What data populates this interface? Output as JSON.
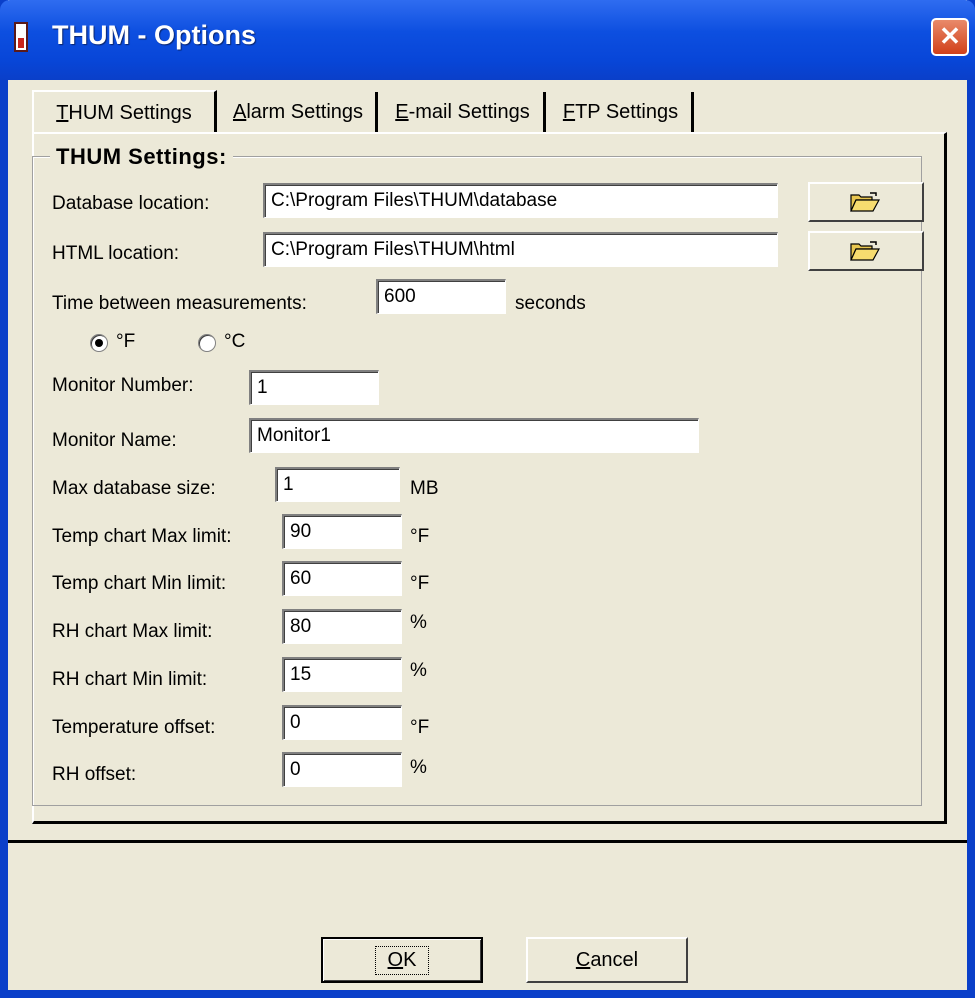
{
  "window": {
    "title": "THUM - Options",
    "close_glyph": "✕"
  },
  "tabs": [
    {
      "label": "THUM Settings",
      "mnemonic": "T",
      "rest": "HUM Settings",
      "active": true
    },
    {
      "label": "Alarm Settings",
      "mnemonic": "A",
      "rest": "larm Settings",
      "active": false
    },
    {
      "label": "E-mail Settings",
      "mnemonic": "E",
      "rest": "-mail Settings",
      "active": false
    },
    {
      "label": "FTP Settings",
      "mnemonic": "F",
      "rest": "TP Settings",
      "active": false
    }
  ],
  "group": {
    "title": "THUM Settings:"
  },
  "fields": {
    "database_location": {
      "label": "Database location:",
      "value": "C:\\Program Files\\THUM\\database"
    },
    "html_location": {
      "label": "HTML location:",
      "value": "C:\\Program Files\\THUM\\html"
    },
    "time_between": {
      "label": "Time between measurements:",
      "value": "600",
      "unit": "seconds"
    },
    "monitor_number": {
      "label": "Monitor Number:",
      "value": "1"
    },
    "monitor_name": {
      "label": "Monitor Name:",
      "value": "Monitor1"
    },
    "max_db_size": {
      "label": "Max database size:",
      "value": "1",
      "unit": "MB"
    },
    "temp_max": {
      "label": "Temp chart Max limit:",
      "value": "90",
      "unit": "°F"
    },
    "temp_min": {
      "label": "Temp chart Min limit:",
      "value": "60",
      "unit": "°F"
    },
    "rh_max": {
      "label": "RH chart Max limit:",
      "value": "80",
      "unit": "%"
    },
    "rh_min": {
      "label": "RH chart Min limit:",
      "value": "15",
      "unit": "%"
    },
    "temp_offset": {
      "label": "Temperature offset:",
      "value": "0",
      "unit": "°F"
    },
    "rh_offset": {
      "label": "RH offset:",
      "value": "0",
      "unit": "%"
    }
  },
  "units_radio": {
    "fahrenheit": {
      "label": "°F",
      "checked": true
    },
    "celsius": {
      "label": "°C",
      "checked": false
    }
  },
  "buttons": {
    "ok": {
      "label": "OK",
      "mnemonic": "O",
      "rest": "K"
    },
    "cancel": {
      "label": "Cancel",
      "mnemonic": "C",
      "rest": "ancel"
    }
  },
  "icons": {
    "browse": "folder-open-icon",
    "app": "thermometer-icon"
  }
}
